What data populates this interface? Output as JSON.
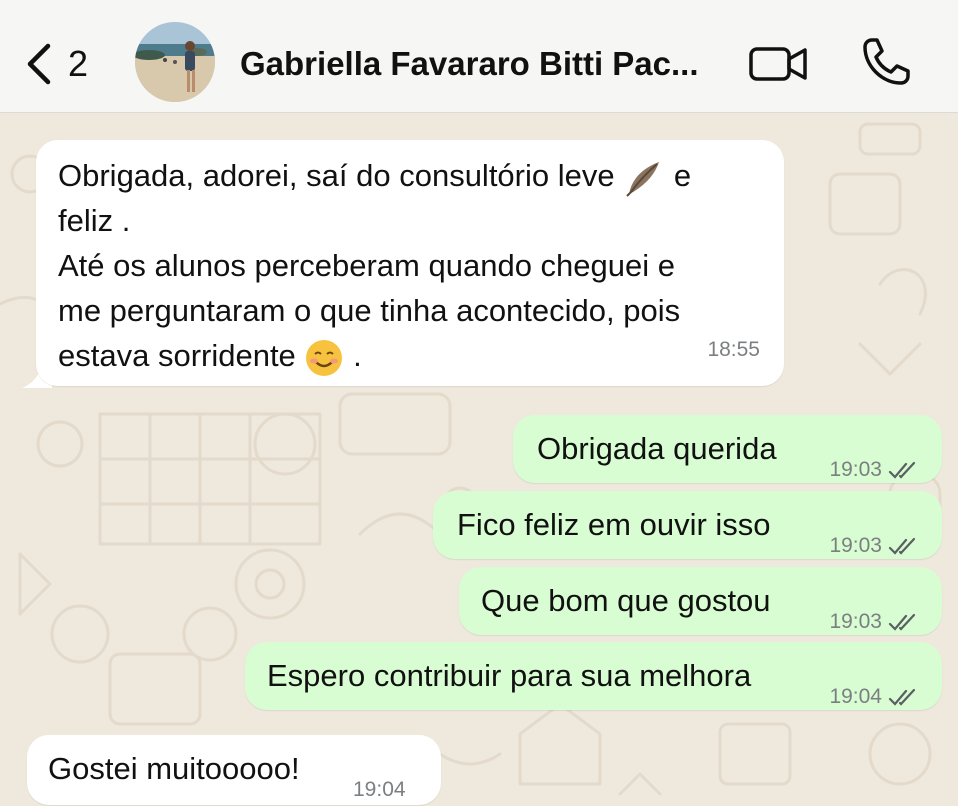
{
  "header": {
    "back_count": "2",
    "contact_name": "Gabriella Favararo Bitti Pac...",
    "icons": {
      "back": "chevron-left-icon",
      "video": "video-camera-icon",
      "call": "phone-icon"
    }
  },
  "messages": [
    {
      "direction": "incoming",
      "lines": [
        "Obrigada, adorei, saí do consultório leve",
        "e",
        "feliz .",
        "Até os alunos perceberam quando cheguei e",
        "me perguntaram o que tinha acontecido, pois",
        "estava sorridente",
        "."
      ],
      "emojis": [
        "feather-emoji",
        "smiling-face-emoji"
      ],
      "time": "18:55"
    },
    {
      "direction": "outgoing",
      "text": "Obrigada querida",
      "time": "19:03",
      "status": "read"
    },
    {
      "direction": "outgoing",
      "text": "Fico feliz em ouvir isso",
      "time": "19:03",
      "status": "read"
    },
    {
      "direction": "outgoing",
      "text": "Que bom que gostou",
      "time": "19:03",
      "status": "read"
    },
    {
      "direction": "outgoing",
      "text": "Espero contribuir para sua melhora",
      "time": "19:04",
      "status": "read"
    },
    {
      "direction": "incoming",
      "text": "Gostei muitooooo!",
      "time": "19:04"
    }
  ],
  "colors": {
    "header_bg": "#f6f6f5",
    "wallpaper": "#efe8dc",
    "incoming_bubble": "#ffffff",
    "outgoing_bubble": "#d8fdd2",
    "timestamp": "#7c7f81"
  }
}
